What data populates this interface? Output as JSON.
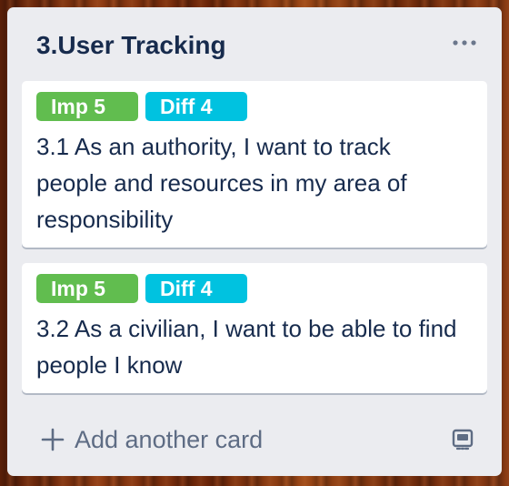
{
  "list": {
    "title": "3.User Tracking",
    "menu_icon": "ellipsis-icon"
  },
  "cards": [
    {
      "labels": [
        {
          "text": "Imp 5",
          "color": "#61bd4f"
        },
        {
          "text": "Diff 4",
          "color": "#00c2e0"
        }
      ],
      "title": "3.1 As an authority, I want to track people and resources in my area of responsibility"
    },
    {
      "labels": [
        {
          "text": "Imp 5",
          "color": "#61bd4f"
        },
        {
          "text": "Diff 4",
          "color": "#00c2e0"
        }
      ],
      "title": "3.2 As a civilian, I want to be able to find people I know"
    }
  ],
  "composer": {
    "add_label": "Add another card",
    "add_icon": "plus-icon",
    "template_icon": "card-template-icon"
  },
  "colors": {
    "list_bg": "#ebecf0",
    "text": "#172b4d",
    "muted": "#5e6c84"
  }
}
